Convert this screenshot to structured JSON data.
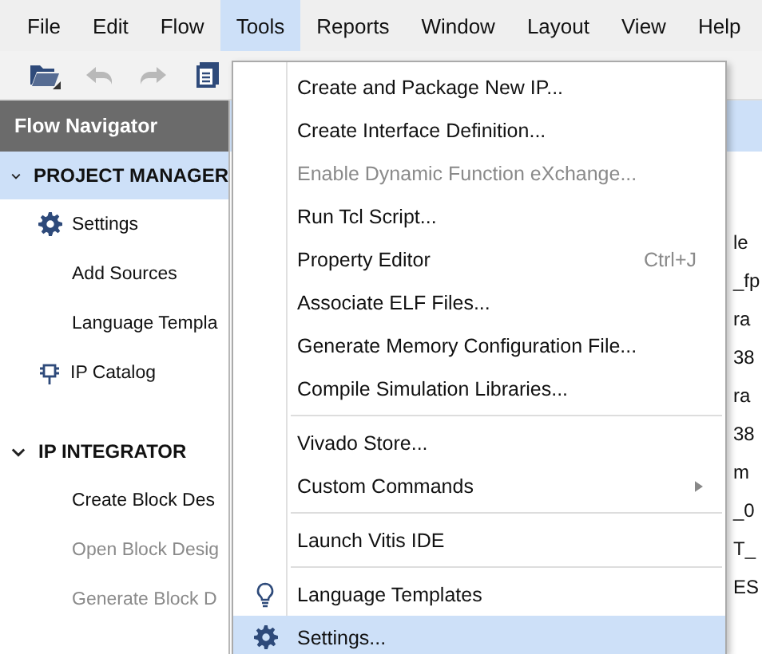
{
  "menubar": [
    {
      "label": "File",
      "selected": false
    },
    {
      "label": "Edit",
      "selected": false
    },
    {
      "label": "Flow",
      "selected": false
    },
    {
      "label": "Tools",
      "selected": true
    },
    {
      "label": "Reports",
      "selected": false
    },
    {
      "label": "Window",
      "selected": false
    },
    {
      "label": "Layout",
      "selected": false
    },
    {
      "label": "View",
      "selected": false
    },
    {
      "label": "Help",
      "selected": false
    }
  ],
  "toolbar": [
    {
      "kind": "open",
      "disabled": false
    },
    {
      "kind": "undo",
      "disabled": true
    },
    {
      "kind": "redo",
      "disabled": true
    },
    {
      "kind": "document",
      "disabled": false
    }
  ],
  "flow_navigator": {
    "title": "Flow Navigator",
    "sections": [
      {
        "title": "PROJECT MANAGER",
        "expanded": true,
        "selected": true,
        "items": [
          {
            "kind": "gear",
            "label": "Settings",
            "disabled": false
          },
          {
            "kind": "plain",
            "label": "Add Sources",
            "disabled": false
          },
          {
            "kind": "plain",
            "label": "Language Templa",
            "disabled": false
          },
          {
            "kind": "chip",
            "label": "IP Catalog",
            "disabled": false
          }
        ]
      },
      {
        "title": "IP INTEGRATOR",
        "expanded": true,
        "selected": false,
        "items": [
          {
            "kind": "plain",
            "label": "Create Block Des",
            "disabled": false
          },
          {
            "kind": "plain",
            "label": "Open Block Desig",
            "disabled": true
          },
          {
            "kind": "plain",
            "label": "Generate Block D",
            "disabled": true
          }
        ]
      }
    ]
  },
  "background_fragments": [
    "le",
    "_fp",
    "ra",
    "38",
    "ra",
    "38",
    "m",
    "_0",
    "T_",
    "ES"
  ],
  "tools_menu": [
    {
      "kind": "item",
      "label": "Create and Package New IP...",
      "disabled": false,
      "selected": false
    },
    {
      "kind": "item",
      "label": "Create Interface Definition...",
      "disabled": false,
      "selected": false
    },
    {
      "kind": "item",
      "label": "Enable Dynamic Function eXchange...",
      "disabled": true,
      "selected": false
    },
    {
      "kind": "item",
      "label": "Run Tcl Script...",
      "disabled": false,
      "selected": false
    },
    {
      "kind": "item",
      "label": "Property Editor",
      "shortcut": "Ctrl+J",
      "disabled": false,
      "selected": false
    },
    {
      "kind": "item",
      "label": "Associate ELF Files...",
      "disabled": false,
      "selected": false
    },
    {
      "kind": "item",
      "label": "Generate Memory Configuration File...",
      "disabled": false,
      "selected": false
    },
    {
      "kind": "item",
      "label": "Compile Simulation Libraries...",
      "disabled": false,
      "selected": false
    },
    {
      "kind": "separator"
    },
    {
      "kind": "item",
      "label": "Vivado Store...",
      "disabled": false,
      "selected": false
    },
    {
      "kind": "submenu",
      "label": "Custom Commands",
      "disabled": false,
      "selected": false
    },
    {
      "kind": "separator"
    },
    {
      "kind": "item",
      "label": "Launch Vitis IDE",
      "disabled": false,
      "selected": false
    },
    {
      "kind": "separator"
    },
    {
      "kind": "bulb",
      "label": "Language Templates",
      "disabled": false,
      "selected": false
    },
    {
      "kind": "gear",
      "label": "Settings...",
      "disabled": false,
      "selected": true
    }
  ]
}
